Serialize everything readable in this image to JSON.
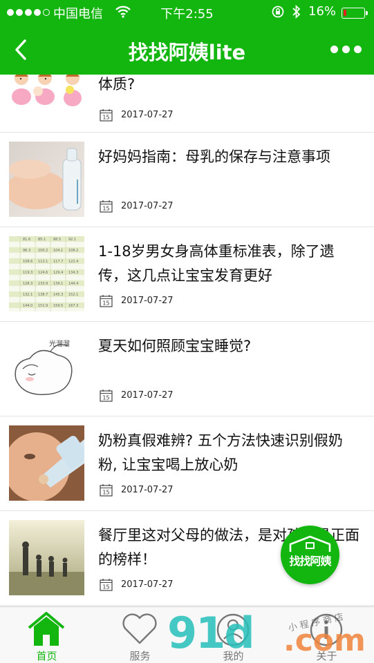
{
  "status_bar": {
    "carrier": "中国电信",
    "time": "下午2:55",
    "battery_percent": "16%",
    "battery_level": 0.16,
    "signal_bars_filled": 4,
    "signal_bars_total": 5
  },
  "nav": {
    "title": "找找阿姨lite",
    "back_icon": "chevron-left-icon",
    "more_icon": "more-dots-icon"
  },
  "articles": [
    {
      "title": "体质?",
      "date": "2017-07-27",
      "thumb": "babies-illustration"
    },
    {
      "title": "好妈妈指南：母乳的保存与注意事项",
      "date": "2017-07-27",
      "thumb": "baby-bottle-photo"
    },
    {
      "title": "1-18岁男女身高体重标准表，除了遗传，这几点让宝宝发育更好",
      "date": "2017-07-27",
      "thumb": "height-weight-table"
    },
    {
      "title": "夏天如何照顾宝宝睡觉?",
      "date": "2017-07-27",
      "thumb": "sleeping-baby-cartoon"
    },
    {
      "title": "奶粉真假难辨? 五个方法快速识别假奶粉, 让宝宝喝上放心奶",
      "date": "2017-07-27",
      "thumb": "baby-drinking-bottle-photo"
    },
    {
      "title": "餐厅里这对父母的做法，是对孩子最正面的榜样！",
      "date": "2017-07-27",
      "thumb": "family-walking-photo"
    }
  ],
  "fab": {
    "label": "找找阿姨",
    "icon": "house-icon"
  },
  "tabs": [
    {
      "label": "首页",
      "icon": "home-icon",
      "active": true
    },
    {
      "label": "服务",
      "icon": "heart-icon",
      "active": false
    },
    {
      "label": "我的",
      "icon": "person-icon",
      "active": false
    },
    {
      "label": "关于",
      "icon": "info-icon",
      "active": false
    }
  ],
  "watermark": {
    "number": "91d",
    "domain": ".com",
    "small_text": "小程序商店"
  },
  "colors": {
    "brand_green": "#13b60f",
    "battery_low": "#e0241b",
    "tab_inactive": "#777777"
  }
}
